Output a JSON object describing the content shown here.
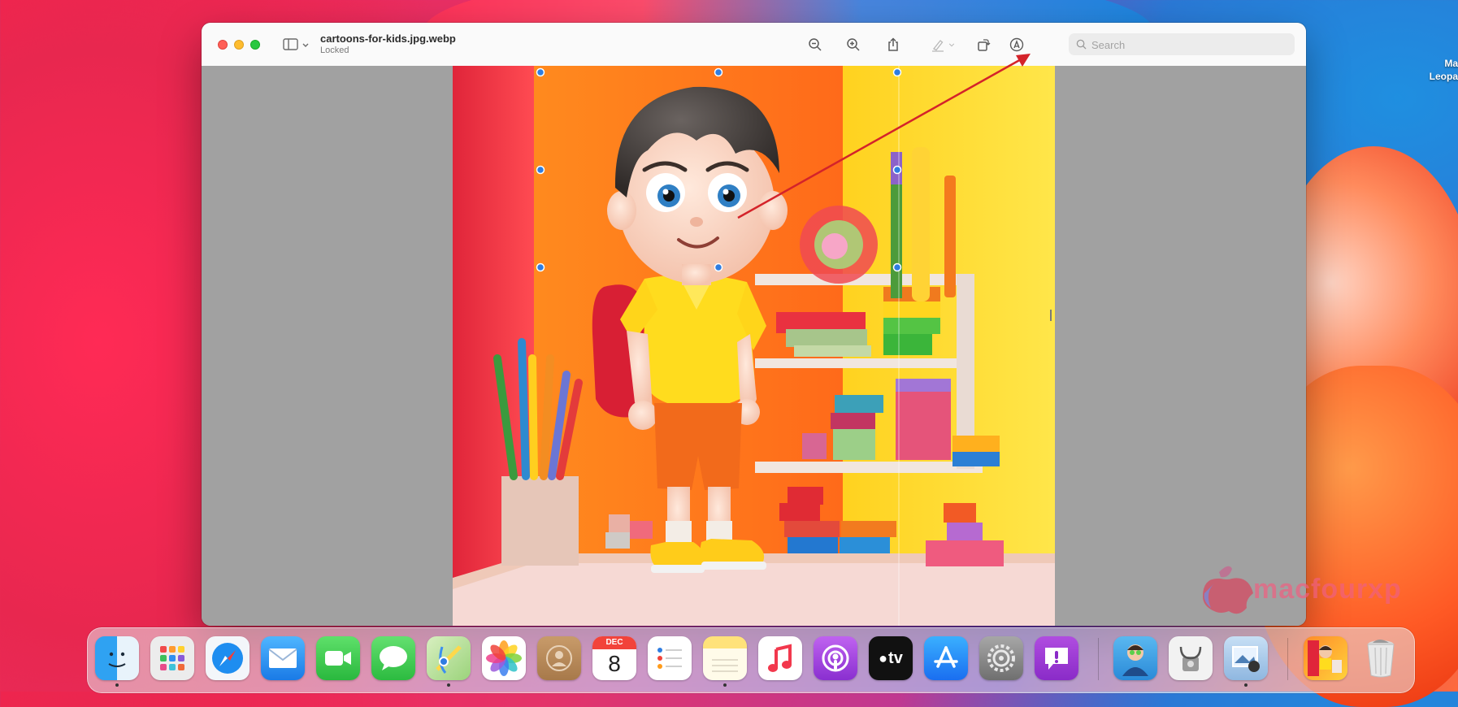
{
  "desktop": {
    "item_label_line1": "Ma",
    "item_label_line2": "Leopa"
  },
  "window": {
    "title": "cartoons-for-kids.jpg.webp",
    "subtitle": "Locked",
    "search_placeholder": "Search"
  },
  "toolbar": {
    "buttons": [
      "sidebar-toggle",
      "zoom-out",
      "zoom-in",
      "share",
      "highlight",
      "rotate",
      "markup"
    ]
  },
  "calendar": {
    "month": "DEC",
    "day": "8"
  },
  "appletv": {
    "label": "tv"
  },
  "watermark": {
    "text": "macfourxp"
  },
  "colors": {
    "red": "#ff5f57",
    "yellow": "#febc2e",
    "green": "#28c840",
    "selection_handle": "#2f7de1",
    "annotation_arrow": "#d4232a"
  }
}
